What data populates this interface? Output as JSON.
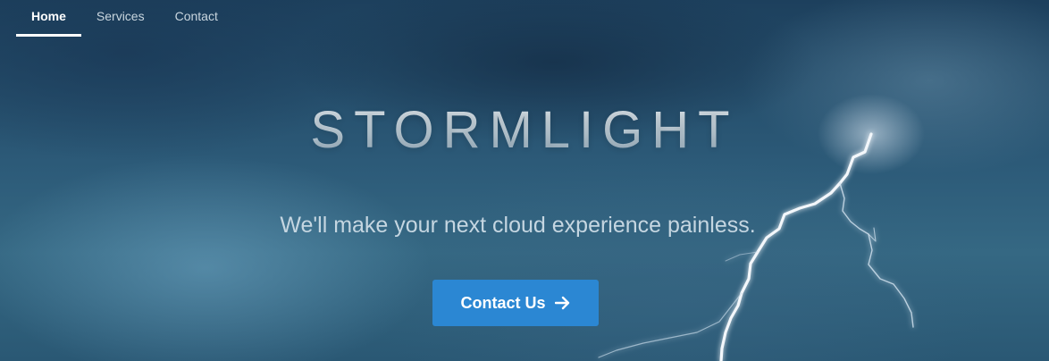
{
  "nav": {
    "tabs": [
      {
        "label": "Home",
        "active": true
      },
      {
        "label": "Services",
        "active": false
      },
      {
        "label": "Contact",
        "active": false
      }
    ]
  },
  "hero": {
    "title": "STORMLIGHT",
    "tagline": "We'll make your next cloud experience painless.",
    "cta_label": "Contact Us",
    "cta_icon": "arrow-right-icon"
  },
  "colors": {
    "cta_background": "#2b87d3",
    "active_tab_text": "#ffffff",
    "inactive_tab_text": "#c9d6df"
  }
}
